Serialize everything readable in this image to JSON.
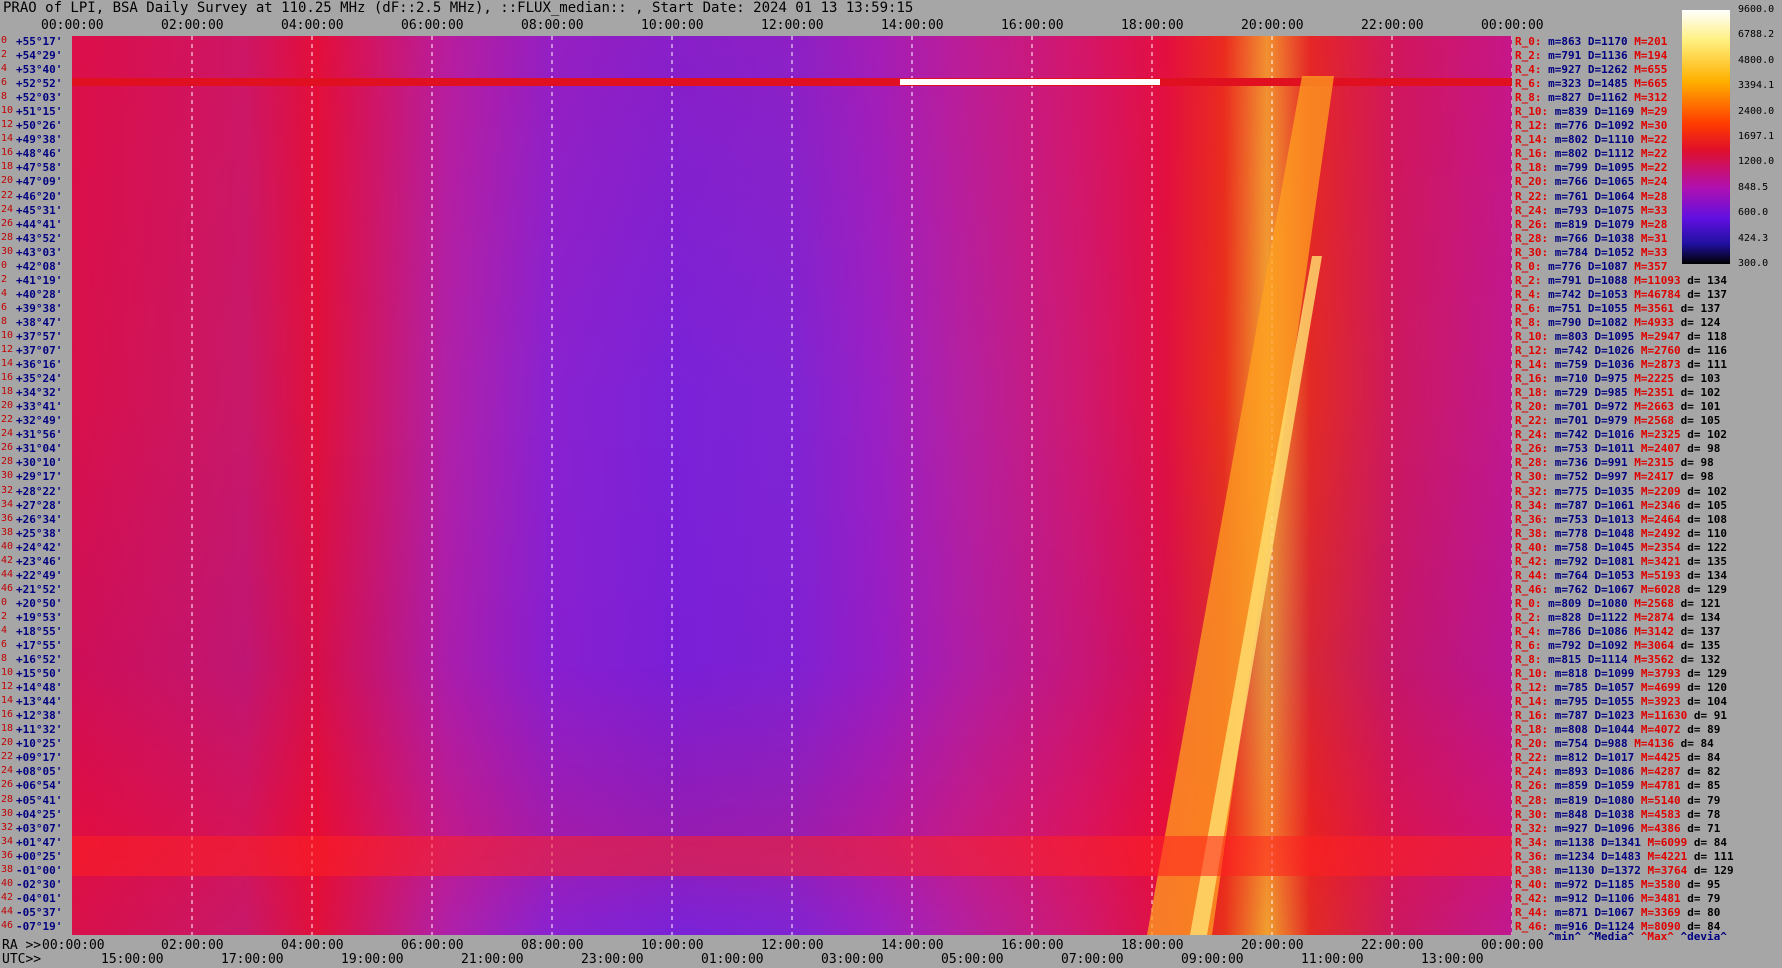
{
  "title": "PRAO of LPI, BSA Daily Survey at 110.25 MHz (dF::2.5 MHz), ::FLUX_median:: , Start Date: 2024 01 13 13:59:15",
  "chart_data": {
    "type": "heatmap",
    "title": "PRAO of LPI, BSA Daily Survey at 110.25 MHz (dF::2.5 MHz), ::FLUX_median:: , Start Date: 2024 01 13 13:59:15",
    "x_top_ticks": [
      "00:00:00",
      "02:00:00",
      "04:00:00",
      "06:00:00",
      "08:00:00",
      "10:00:00",
      "12:00:00",
      "14:00:00",
      "16:00:00",
      "18:00:00",
      "20:00:00",
      "22:00:00",
      "00:00:00"
    ],
    "x_bottom_ra_ticks": [
      "00:00:00",
      "02:00:00",
      "04:00:00",
      "06:00:00",
      "08:00:00",
      "10:00:00",
      "12:00:00",
      "14:00:00",
      "16:00:00",
      "18:00:00",
      "20:00:00",
      "22:00:00",
      "00:00:00"
    ],
    "x_bottom_utc_ticks": [
      "15:00:00",
      "17:00:00",
      "19:00:00",
      "21:00:00",
      "23:00:00",
      "01:00:00",
      "03:00:00",
      "05:00:00",
      "07:00:00",
      "09:00:00",
      "11:00:00",
      "13:00:00"
    ],
    "bottom_left_ra_label": "RA >>",
    "bottom_left_utc_label": "UTC>>",
    "declinations": [
      "+55°17'",
      "+54°29'",
      "+53°40'",
      "+52°52'",
      "+52°03'",
      "+51°15'",
      "+50°26'",
      "+49°38'",
      "+48°46'",
      "+47°58'",
      "+47°09'",
      "+46°20'",
      "+45°31'",
      "+44°41'",
      "+43°52'",
      "+43°03'",
      "+42°08'",
      "+41°19'",
      "+40°28'",
      "+39°38'",
      "+38°47'",
      "+37°57'",
      "+37°07'",
      "+36°16'",
      "+35°24'",
      "+34°32'",
      "+33°41'",
      "+32°49'",
      "+31°56'",
      "+31°04'",
      "+30°10'",
      "+29°17'",
      "+28°22'",
      "+27°28'",
      "+26°34'",
      "+25°38'",
      "+24°42'",
      "+23°46'",
      "+22°49'",
      "+21°52'",
      "+20°50'",
      "+19°53'",
      "+18°55'",
      "+17°55'",
      "+16°52'",
      "+15°50'",
      "+14°48'",
      "+13°44'",
      "+12°38'",
      "+11°32'",
      "+10°25'",
      "+09°17'",
      "+08°05'",
      "+06°54'",
      "+05°41'",
      "+04°25'",
      "+03°07'",
      "+01°47'",
      "+00°25'",
      "-01°00'",
      "-02°30'",
      "-04°01'",
      "-05°37'",
      "-07°19'"
    ],
    "declination_indices": [
      "0",
      "2",
      "4",
      "6",
      "8",
      "10",
      "12",
      "14",
      "16",
      "18",
      "20",
      "22",
      "24",
      "26",
      "28",
      "30",
      "0",
      "2",
      "4",
      "6",
      "8",
      "10",
      "12",
      "14",
      "16",
      "18",
      "20",
      "22",
      "24",
      "26",
      "28",
      "30",
      "32",
      "34",
      "36",
      "38",
      "40",
      "42",
      "44",
      "46",
      "0",
      "2",
      "4",
      "6",
      "8",
      "10",
      "12",
      "14",
      "16",
      "18",
      "20",
      "22",
      "24",
      "26",
      "28",
      "30",
      "32",
      "34",
      "36",
      "38",
      "40",
      "42",
      "44",
      "46"
    ],
    "colorbar": {
      "ticks": [
        "9600.0",
        "6788.2",
        "4800.0",
        "3394.1",
        "2400.0",
        "1697.1",
        "1200.0",
        "848.5",
        "600.0",
        "424.3",
        "300.0"
      ],
      "scale": "log",
      "range": [
        300.0,
        9600.0
      ]
    },
    "stats_legend": [
      "^min^",
      "^Media^",
      "^Max^",
      "^devia^"
    ],
    "stats": [
      {
        "r": "R_0:",
        "m": "m=863",
        "D": "D=1170",
        "M": "M=201",
        "d": ""
      },
      {
        "r": "R_2:",
        "m": "m=791",
        "D": "D=1136",
        "M": "M=194",
        "d": ""
      },
      {
        "r": "R_4:",
        "m": "m=927",
        "D": "D=1262",
        "M": "M=655",
        "d": ""
      },
      {
        "r": "R_6:",
        "m": "m=323",
        "D": "D=1485",
        "M": "M=665",
        "d": ""
      },
      {
        "r": "R_8:",
        "m": "m=827",
        "D": "D=1162",
        "M": "M=312",
        "d": ""
      },
      {
        "r": "R_10:",
        "m": "m=839",
        "D": "D=1169",
        "M": "M=29",
        "d": ""
      },
      {
        "r": "R_12:",
        "m": "m=776",
        "D": "D=1092",
        "M": "M=30",
        "d": ""
      },
      {
        "r": "R_14:",
        "m": "m=802",
        "D": "D=1110",
        "M": "M=22",
        "d": ""
      },
      {
        "r": "R_16:",
        "m": "m=802",
        "D": "D=1112",
        "M": "M=22",
        "d": ""
      },
      {
        "r": "R_18:",
        "m": "m=799",
        "D": "D=1095",
        "M": "M=22",
        "d": ""
      },
      {
        "r": "R_20:",
        "m": "m=766",
        "D": "D=1065",
        "M": "M=24",
        "d": ""
      },
      {
        "r": "R_22:",
        "m": "m=761",
        "D": "D=1064",
        "M": "M=28",
        "d": ""
      },
      {
        "r": "R_24:",
        "m": "m=793",
        "D": "D=1075",
        "M": "M=33",
        "d": ""
      },
      {
        "r": "R_26:",
        "m": "m=819",
        "D": "D=1079",
        "M": "M=28",
        "d": ""
      },
      {
        "r": "R_28:",
        "m": "m=766",
        "D": "D=1038",
        "M": "M=31",
        "d": ""
      },
      {
        "r": "R_30:",
        "m": "m=784",
        "D": "D=1052",
        "M": "M=33",
        "d": ""
      },
      {
        "r": "R_0:",
        "m": "m=776",
        "D": "D=1087",
        "M": "M=357",
        "d": ""
      },
      {
        "r": "R_2:",
        "m": "m=791",
        "D": "D=1088",
        "M": "M=11093",
        "d": "d= 134"
      },
      {
        "r": "R_4:",
        "m": "m=742",
        "D": "D=1053",
        "M": "M=46784",
        "d": "d= 137"
      },
      {
        "r": "R_6:",
        "m": "m=751",
        "D": "D=1055",
        "M": "M=3561",
        "d": "d= 137"
      },
      {
        "r": "R_8:",
        "m": "m=790",
        "D": "D=1082",
        "M": "M=4933",
        "d": "d= 124"
      },
      {
        "r": "R_10:",
        "m": "m=803",
        "D": "D=1095",
        "M": "M=2947",
        "d": "d= 118"
      },
      {
        "r": "R_12:",
        "m": "m=742",
        "D": "D=1026",
        "M": "M=2760",
        "d": "d= 116"
      },
      {
        "r": "R_14:",
        "m": "m=759",
        "D": "D=1036",
        "M": "M=2873",
        "d": "d= 111"
      },
      {
        "r": "R_16:",
        "m": "m=710",
        "D": "D=975",
        "M": "M=2225",
        "d": "d= 103"
      },
      {
        "r": "R_18:",
        "m": "m=729",
        "D": "D=985",
        "M": "M=2351",
        "d": "d= 102"
      },
      {
        "r": "R_20:",
        "m": "m=701",
        "D": "D=972",
        "M": "M=2663",
        "d": "d= 101"
      },
      {
        "r": "R_22:",
        "m": "m=701",
        "D": "D=979",
        "M": "M=2568",
        "d": "d= 105"
      },
      {
        "r": "R_24:",
        "m": "m=742",
        "D": "D=1016",
        "M": "M=2325",
        "d": "d= 102"
      },
      {
        "r": "R_26:",
        "m": "m=753",
        "D": "D=1011",
        "M": "M=2407",
        "d": "d= 98"
      },
      {
        "r": "R_28:",
        "m": "m=736",
        "D": "D=991",
        "M": "M=2315",
        "d": "d= 98"
      },
      {
        "r": "R_30:",
        "m": "m=752",
        "D": "D=997",
        "M": "M=2417",
        "d": "d= 98"
      },
      {
        "r": "R_32:",
        "m": "m=775",
        "D": "D=1035",
        "M": "M=2209",
        "d": "d= 102"
      },
      {
        "r": "R_34:",
        "m": "m=787",
        "D": "D=1061",
        "M": "M=2346",
        "d": "d= 105"
      },
      {
        "r": "R_36:",
        "m": "m=753",
        "D": "D=1013",
        "M": "M=2464",
        "d": "d= 108"
      },
      {
        "r": "R_38:",
        "m": "m=778",
        "D": "D=1048",
        "M": "M=2492",
        "d": "d= 110"
      },
      {
        "r": "R_40:",
        "m": "m=758",
        "D": "D=1045",
        "M": "M=2354",
        "d": "d= 122"
      },
      {
        "r": "R_42:",
        "m": "m=792",
        "D": "D=1081",
        "M": "M=3421",
        "d": "d= 135"
      },
      {
        "r": "R_44:",
        "m": "m=764",
        "D": "D=1053",
        "M": "M=5193",
        "d": "d= 134"
      },
      {
        "r": "R_46:",
        "m": "m=762",
        "D": "D=1067",
        "M": "M=6028",
        "d": "d= 129"
      },
      {
        "r": "R_0:",
        "m": "m=809",
        "D": "D=1080",
        "M": "M=2568",
        "d": "d= 121"
      },
      {
        "r": "R_2:",
        "m": "m=828",
        "D": "D=1122",
        "M": "M=2874",
        "d": "d= 134"
      },
      {
        "r": "R_4:",
        "m": "m=786",
        "D": "D=1086",
        "M": "M=3142",
        "d": "d= 137"
      },
      {
        "r": "R_6:",
        "m": "m=792",
        "D": "D=1092",
        "M": "M=3064",
        "d": "d= 135"
      },
      {
        "r": "R_8:",
        "m": "m=815",
        "D": "D=1114",
        "M": "M=3562",
        "d": "d= 132"
      },
      {
        "r": "R_10:",
        "m": "m=818",
        "D": "D=1099",
        "M": "M=3793",
        "d": "d= 129"
      },
      {
        "r": "R_12:",
        "m": "m=785",
        "D": "D=1057",
        "M": "M=4699",
        "d": "d= 120"
      },
      {
        "r": "R_14:",
        "m": "m=795",
        "D": "D=1055",
        "M": "M=3923",
        "d": "d= 104"
      },
      {
        "r": "R_16:",
        "m": "m=787",
        "D": "D=1023",
        "M": "M=11630",
        "d": "d= 91"
      },
      {
        "r": "R_18:",
        "m": "m=808",
        "D": "D=1044",
        "M": "M=4072",
        "d": "d= 89"
      },
      {
        "r": "R_20:",
        "m": "m=754",
        "D": "D=988",
        "M": "M=4136",
        "d": "d= 84"
      },
      {
        "r": "R_22:",
        "m": "m=812",
        "D": "D=1017",
        "M": "M=4425",
        "d": "d= 84"
      },
      {
        "r": "R_24:",
        "m": "m=893",
        "D": "D=1086",
        "M": "M=4287",
        "d": "d= 82"
      },
      {
        "r": "R_26:",
        "m": "m=859",
        "D": "D=1059",
        "M": "M=4781",
        "d": "d= 85"
      },
      {
        "r": "R_28:",
        "m": "m=819",
        "D": "D=1080",
        "M": "M=5140",
        "d": "d= 79"
      },
      {
        "r": "R_30:",
        "m": "m=848",
        "D": "D=1038",
        "M": "M=4583",
        "d": "d= 78"
      },
      {
        "r": "R_32:",
        "m": "m=927",
        "D": "D=1096",
        "M": "M=4386",
        "d": "d= 71"
      },
      {
        "r": "R_34:",
        "m": "m=1138",
        "D": "D=1341",
        "M": "M=6099",
        "d": "d= 84"
      },
      {
        "r": "R_36:",
        "m": "m=1234",
        "D": "D=1483",
        "M": "M=4221",
        "d": "d= 111"
      },
      {
        "r": "R_38:",
        "m": "m=1130",
        "D": "D=1372",
        "M": "M=3764",
        "d": "d= 129"
      },
      {
        "r": "R_40:",
        "m": "m=972",
        "D": "D=1185",
        "M": "M=3580",
        "d": "d= 95"
      },
      {
        "r": "R_42:",
        "m": "m=912",
        "D": "D=1106",
        "M": "M=3481",
        "d": "d= 79"
      },
      {
        "r": "R_44:",
        "m": "m=871",
        "D": "D=1067",
        "M": "M=3369",
        "d": "d= 80"
      },
      {
        "r": "R_46:",
        "m": "m=916",
        "D": "D=1124",
        "M": "M=8090",
        "d": "d= 84"
      }
    ],
    "colors": {
      "background": "#a6a6a6",
      "dec_label": "#000080",
      "dec_index": "#c00000",
      "stat_name": "#e00000",
      "grid_line": "#ffffff"
    }
  }
}
